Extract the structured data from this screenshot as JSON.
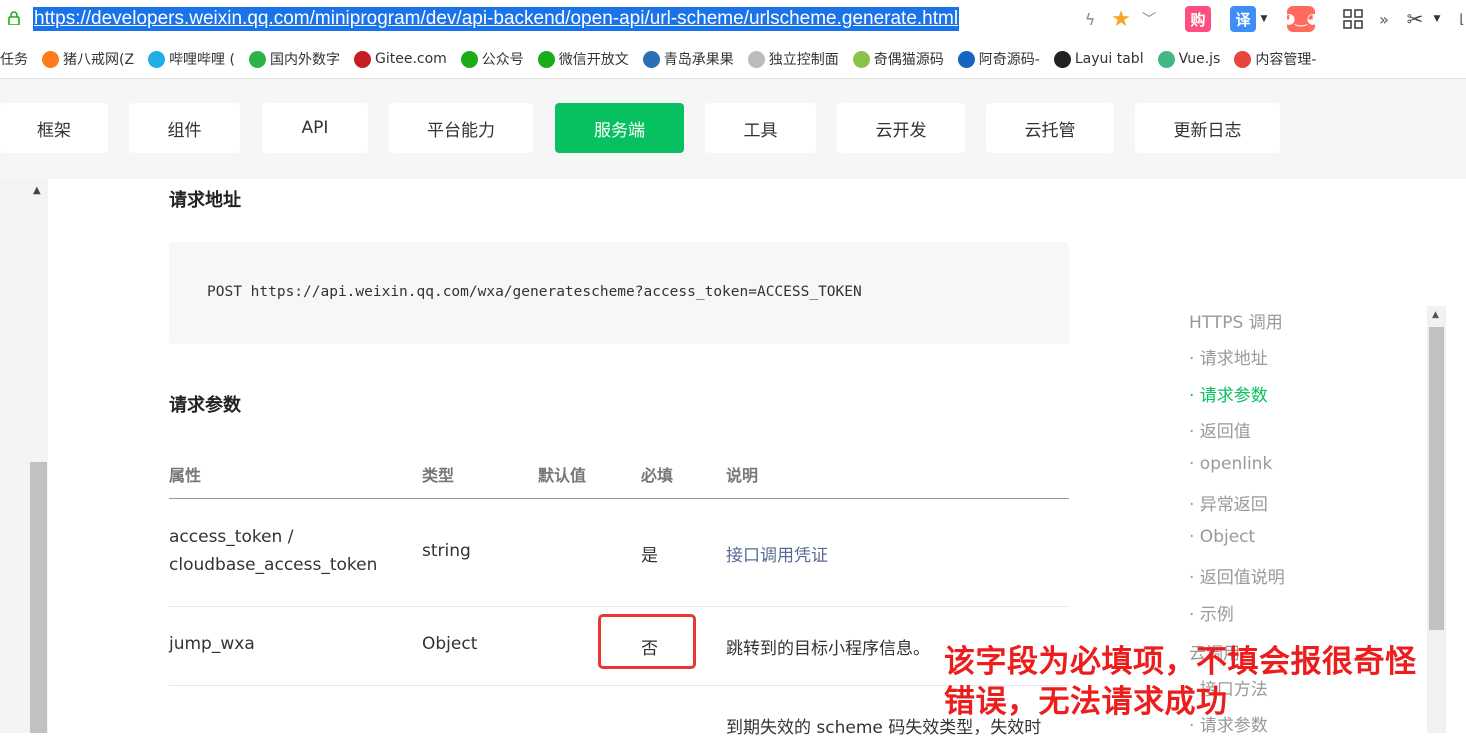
{
  "browser": {
    "url": "https://developers.weixin.qq.com/miniprogram/dev/api-backend/open-api/url-scheme/urlscheme.generate.html",
    "toolbar": {
      "gou_label": "购",
      "yi_label": "译"
    },
    "bookmarks": [
      {
        "label": "任务",
        "icon": "",
        "color": ""
      },
      {
        "label": "猪八戒网(Z",
        "icon": "pig-icon",
        "color": "#ff7a1a"
      },
      {
        "label": "哔哩哔哩 (",
        "icon": "bilibili-icon",
        "color": "#23ade5"
      },
      {
        "label": "国内外数字",
        "icon": "in-icon",
        "color": "#2db34a"
      },
      {
        "label": "Gitee.com",
        "icon": "gitee-icon",
        "color": "#c71d23"
      },
      {
        "label": "公众号",
        "icon": "green-swirl-icon",
        "color": "#1aad19"
      },
      {
        "label": "微信开放文",
        "icon": "wechat-icon",
        "color": "#1aad19"
      },
      {
        "label": "青岛承果果",
        "icon": "m-icon",
        "color": "#2c6fb7"
      },
      {
        "label": "独立控制面",
        "icon": "page-icon",
        "color": "#bbbbbb"
      },
      {
        "label": "奇偶猫源码",
        "icon": "cat-icon",
        "color": "#8bc34a"
      },
      {
        "label": "阿奇源码-",
        "icon": "shield-icon",
        "color": "#1565c0"
      },
      {
        "label": "Layui tabl",
        "icon": "layui-icon",
        "color": "#222222"
      },
      {
        "label": "Vue.js",
        "icon": "vue-icon",
        "color": "#41b883"
      },
      {
        "label": "内容管理-",
        "icon": "c-icon",
        "color": "#e8453c"
      }
    ]
  },
  "nav": {
    "tabs": [
      {
        "label": "框架"
      },
      {
        "label": "组件"
      },
      {
        "label": "API"
      },
      {
        "label": "平台能力"
      },
      {
        "label": "服务端",
        "active": true
      },
      {
        "label": "工具"
      },
      {
        "label": "云开发"
      },
      {
        "label": "云托管"
      },
      {
        "label": "更新日志"
      }
    ]
  },
  "content": {
    "section_address": "请求地址",
    "request_line": "POST https://api.weixin.qq.com/wxa/generatescheme?access_token=ACCESS_TOKEN",
    "section_params": "请求参数",
    "table": {
      "headers": [
        "属性",
        "类型",
        "默认值",
        "必填",
        "说明"
      ],
      "rows": [
        {
          "attr_line1": "access_token /",
          "attr_line2": "cloudbase_access_token",
          "type": "string",
          "default": "",
          "required": "是",
          "desc": "接口调用凭证"
        },
        {
          "attr": "jump_wxa",
          "type": "Object",
          "default": "",
          "required": "否",
          "desc": "跳转到的目标小程序信息。"
        },
        {
          "desc_partial": "到期失效的 scheme 码失效类型，失效时"
        }
      ]
    }
  },
  "toc": {
    "items": [
      {
        "label": "HTTPS 调用"
      },
      {
        "label": "· 请求地址"
      },
      {
        "label": "· 请求参数",
        "active": true
      },
      {
        "label": "· 返回值"
      },
      {
        "label": "· openlink"
      },
      {
        "label": "· 异常返回"
      },
      {
        "label": "· Object"
      },
      {
        "label": "· 返回值说明"
      },
      {
        "label": "· 示例"
      },
      {
        "label": "云调用"
      },
      {
        "label": "· 接口方法"
      },
      {
        "label": "· 请求参数"
      }
    ]
  },
  "annotation": {
    "line1": "该字段为必填项，不填会报很奇怪",
    "line2": "错误，无法请求成功",
    "color": "#ee1d1d"
  },
  "colors": {
    "brand_green": "#07c160",
    "link": "#576b95"
  }
}
